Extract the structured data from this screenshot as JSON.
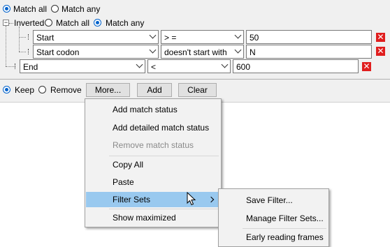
{
  "top_radios": {
    "match_all": "Match all",
    "match_any": "Match any"
  },
  "group": {
    "inverted": "Inverted",
    "match_all": "Match all",
    "match_any": "Match any"
  },
  "rows": [
    {
      "field": "Start",
      "op": "> =",
      "value": "50"
    },
    {
      "field": "Start codon",
      "op": "doesn't start with",
      "value": "N"
    },
    {
      "field": "End",
      "op": "<",
      "value": "600"
    }
  ],
  "actions": {
    "keep": "Keep",
    "remove": "Remove",
    "more": "More...",
    "add": "Add",
    "clear": "Clear"
  },
  "menu": {
    "items": [
      "Add match status",
      "Add detailed match status",
      "Remove match status",
      "Copy All",
      "Paste",
      "Filter Sets",
      "Show maximized"
    ],
    "submenu": [
      "Save Filter...",
      "Manage Filter Sets...",
      "Early reading frames"
    ]
  },
  "colors": {
    "highlight": "#99c9ef",
    "delete": "#e01e1e",
    "radio_on": "#0062cc"
  }
}
